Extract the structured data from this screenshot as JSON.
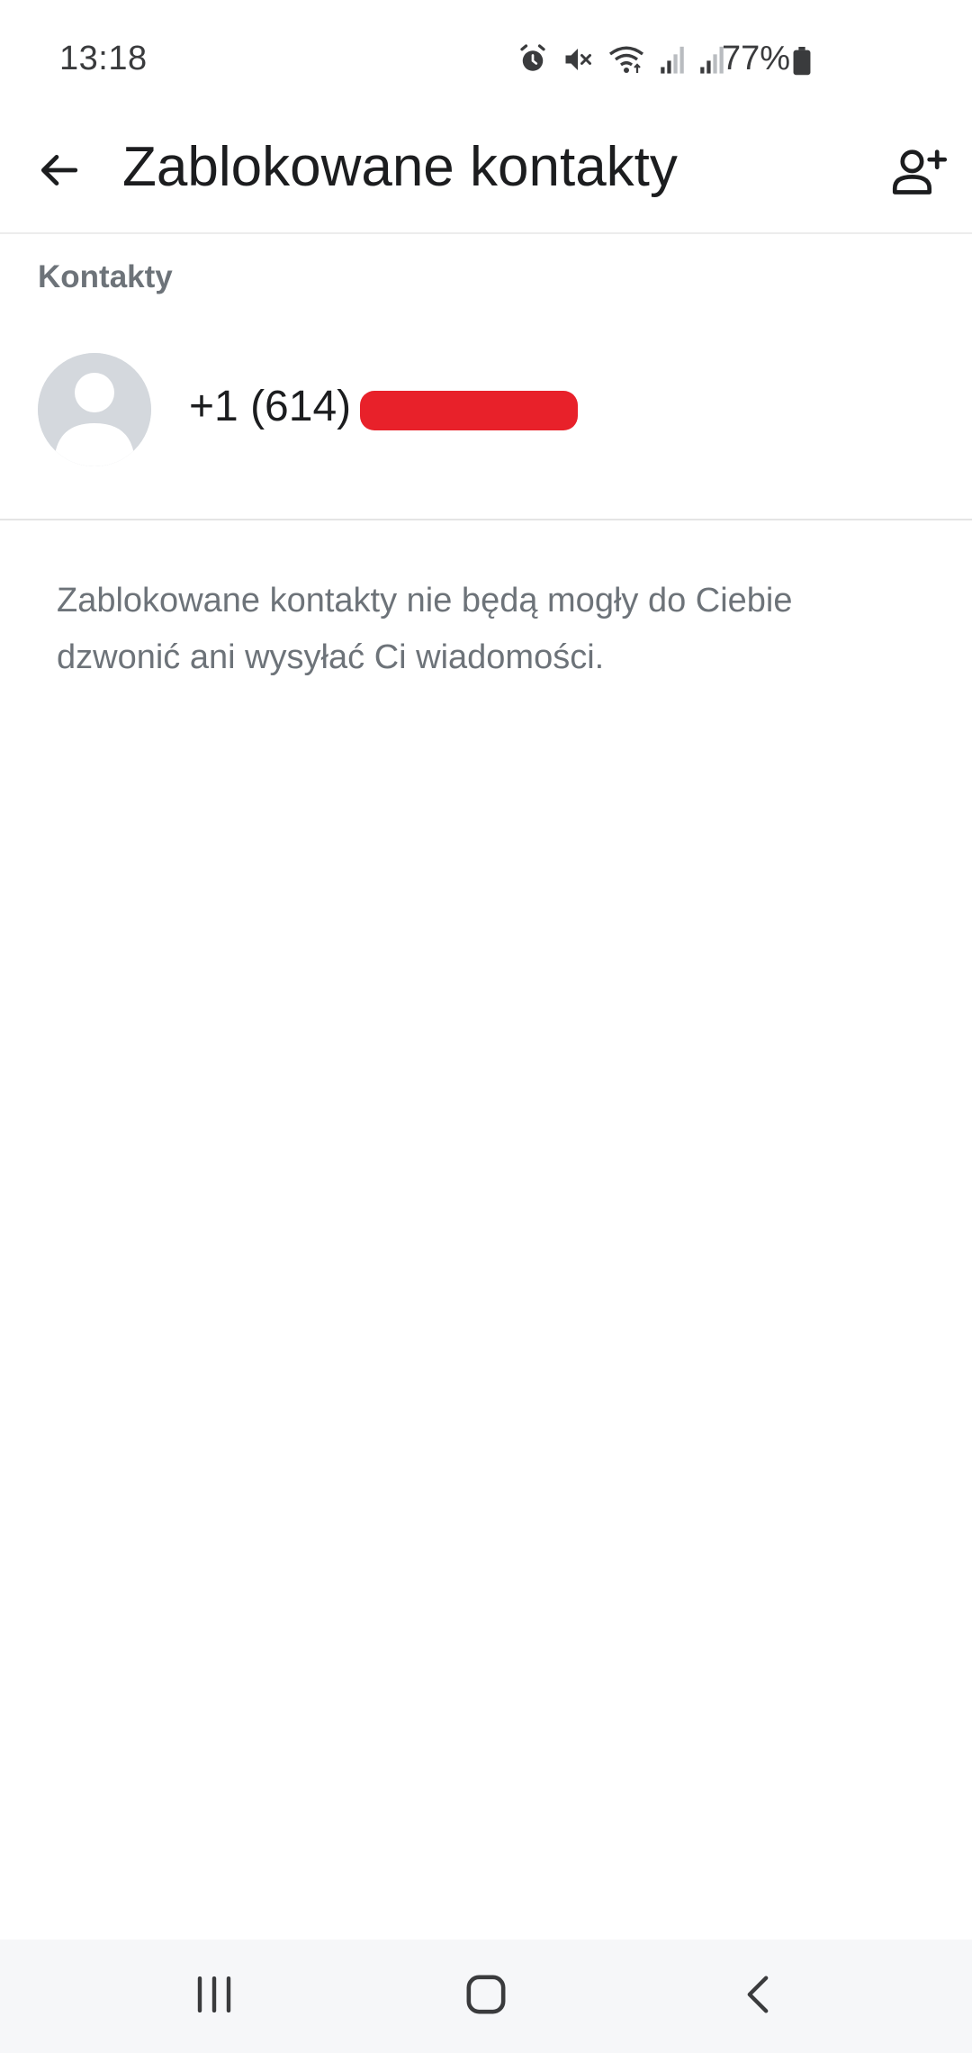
{
  "status_bar": {
    "time": "13:18",
    "battery": "77%",
    "icons": [
      "alarm-icon",
      "mute-icon",
      "wifi-icon",
      "signal-icon",
      "signal-icon"
    ]
  },
  "app_bar": {
    "title": "Zablokowane kontakty",
    "back_icon": "arrow-left-icon",
    "add_icon": "add-contact-icon"
  },
  "section": {
    "header": "Kontakty"
  },
  "contacts": [
    {
      "number": "+1 (614)",
      "redacted": true
    }
  ],
  "info": {
    "text": "Zablokowane kontakty nie będą mogły do Ciebie dzwonić ani wysyłać Ci wiadomości."
  },
  "nav_bar": {
    "icons": [
      "recent-apps-icon",
      "home-icon",
      "back-nav-icon"
    ]
  },
  "colors": {
    "redaction": "#e8212a",
    "secondary_text": "#6d7379",
    "avatar_bg": "#d4d8dd"
  }
}
